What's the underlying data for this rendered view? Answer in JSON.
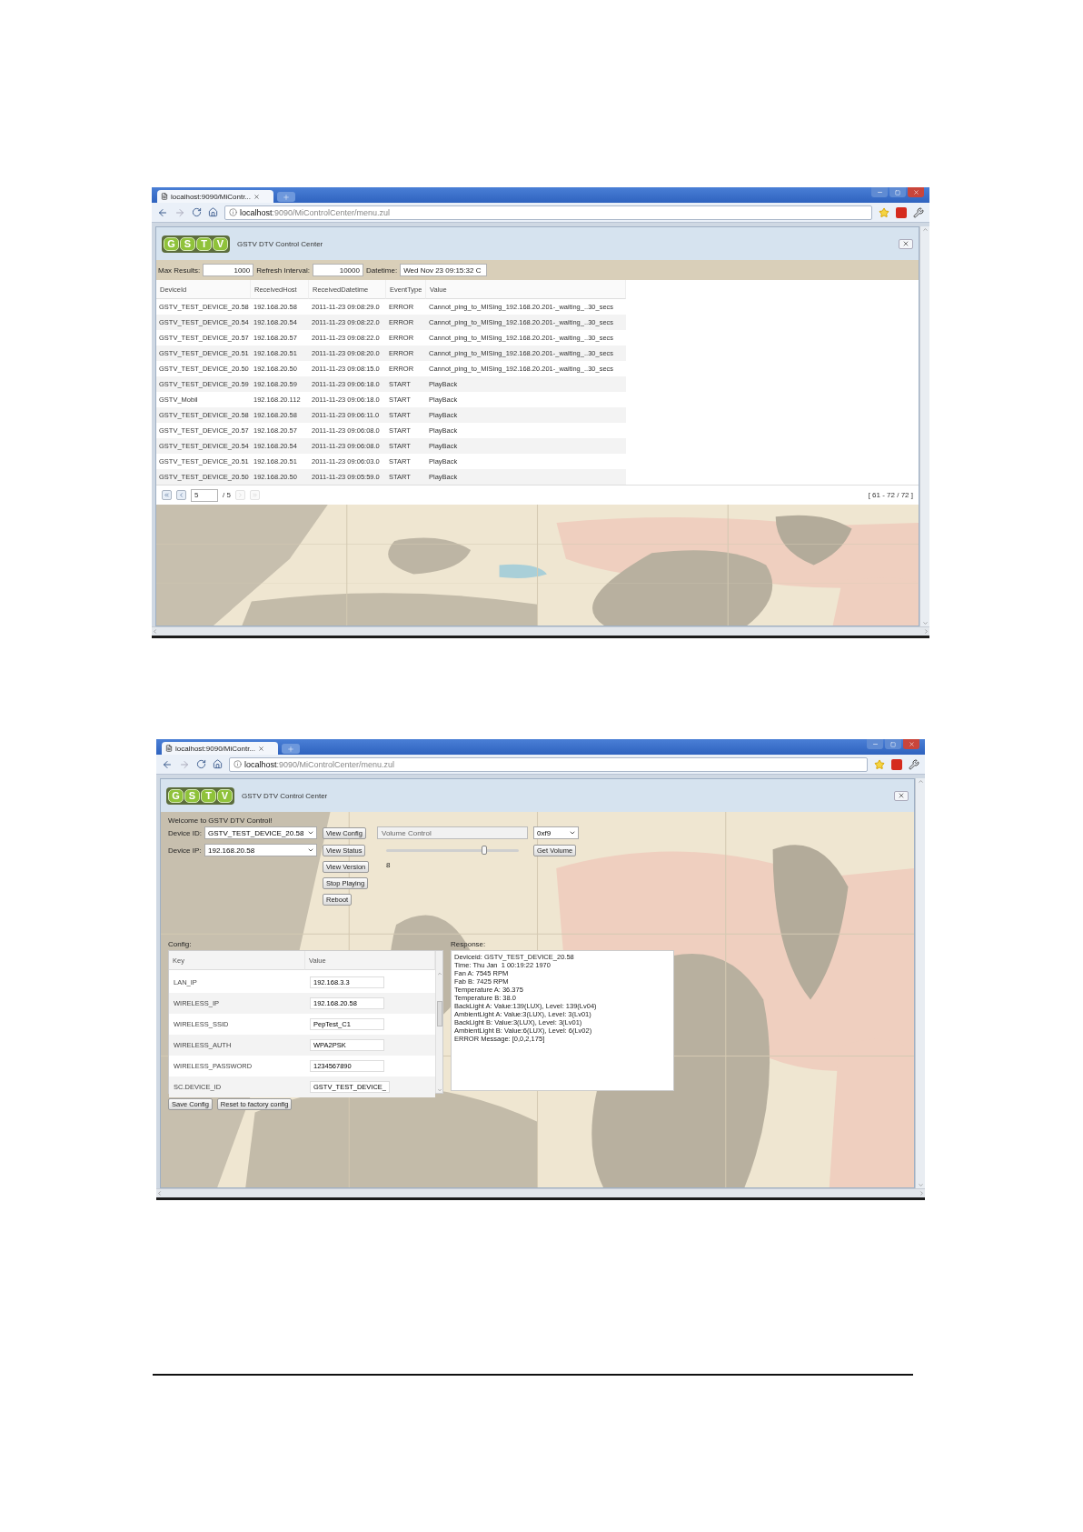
{
  "screenshots": [
    {
      "kind": "event-log",
      "browser": {
        "tab_title": "localhost:9090/MiContr...",
        "url_host": "localhost",
        "url_path": ":9090/MiControlCenter/menu.zul"
      },
      "app": {
        "logo_letters": [
          "G",
          "S",
          "T",
          "V"
        ],
        "title": "GSTV DTV Control Center"
      },
      "filters": [
        {
          "label": "Max Results:",
          "value": "1000"
        },
        {
          "label": "Refresh Interval:",
          "value": "10000"
        },
        {
          "label": "Datetime:",
          "value": "Wed Nov 23 09:15:32 C"
        }
      ],
      "table": {
        "columns": [
          "DeviceId",
          "ReceivedHost",
          "ReceivedDatetime",
          "EventType",
          "Value"
        ],
        "rows": [
          [
            "GSTV_TEST_DEVICE_20.58",
            "192.168.20.58",
            "2011-11-23 09:08:29.0",
            "ERROR",
            "Cannot_ping_to_MISing_192.168.20.201-_waiting_..30_secs"
          ],
          [
            "GSTV_TEST_DEVICE_20.54",
            "192.168.20.54",
            "2011-11-23 09:08:22.0",
            "ERROR",
            "Cannot_ping_to_MISing_192.168.20.201-_waiting_..30_secs"
          ],
          [
            "GSTV_TEST_DEVICE_20.57",
            "192.168.20.57",
            "2011-11-23 09:08:22.0",
            "ERROR",
            "Cannot_ping_to_MISing_192.168.20.201-_waiting_..30_secs"
          ],
          [
            "GSTV_TEST_DEVICE_20.51",
            "192.168.20.51",
            "2011-11-23 09:08:20.0",
            "ERROR",
            "Cannot_ping_to_MISing_192.168.20.201-_waiting_..30_secs"
          ],
          [
            "GSTV_TEST_DEVICE_20.50",
            "192.168.20.50",
            "2011-11-23 09:08:15.0",
            "ERROR",
            "Cannot_ping_to_MISing_192.168.20.201-_waiting_..30_secs"
          ],
          [
            "GSTV_TEST_DEVICE_20.59",
            "192.168.20.59",
            "2011-11-23 09:06:18.0",
            "START",
            "PlayBack"
          ],
          [
            "GSTV_Mobil",
            "192.168.20.112",
            "2011-11-23 09:06:18.0",
            "START",
            "PlayBack"
          ],
          [
            "GSTV_TEST_DEVICE_20.58",
            "192.168.20.58",
            "2011-11-23 09:06:11.0",
            "START",
            "PlayBack"
          ],
          [
            "GSTV_TEST_DEVICE_20.57",
            "192.168.20.57",
            "2011-11-23 09:06:08.0",
            "START",
            "PlayBack"
          ],
          [
            "GSTV_TEST_DEVICE_20.54",
            "192.168.20.54",
            "2011-11-23 09:06:08.0",
            "START",
            "PlayBack"
          ],
          [
            "GSTV_TEST_DEVICE_20.51",
            "192.168.20.51",
            "2011-11-23 09:06:03.0",
            "START",
            "PlayBack"
          ],
          [
            "GSTV_TEST_DEVICE_20.50",
            "192.168.20.50",
            "2011-11-23 09:05:59.0",
            "START",
            "PlayBack"
          ]
        ]
      },
      "pager": {
        "buttons": [
          {
            "kind": "first",
            "disabled": false
          },
          {
            "kind": "prev",
            "disabled": false
          },
          {
            "kind": "next",
            "disabled": true
          },
          {
            "kind": "last",
            "disabled": true
          }
        ],
        "page": "5",
        "total": "/ 5",
        "range": "[ 61 - 72 / 72 ]"
      }
    },
    {
      "kind": "device-control",
      "browser": {
        "tab_title": "localhost:9090/MiContr...",
        "url_host": "localhost",
        "url_path": ":9090/MiControlCenter/menu.zul"
      },
      "app": {
        "logo_letters": [
          "G",
          "S",
          "T",
          "V"
        ],
        "title": "GSTV DTV Control Center"
      },
      "welcome": "Welcome to GSTV DTV Control!",
      "device_id": {
        "label": "Device ID:",
        "value": "GSTV_TEST_DEVICE_20.58"
      },
      "device_ip": {
        "label": "Device IP:",
        "value": "192.168.20.58"
      },
      "buttons": [
        "View Config",
        "View Status",
        "View Version",
        "Stop Playing",
        "Reboot"
      ],
      "volume": {
        "field": "Volume Control",
        "select": "0xf9",
        "level": 0.74,
        "reading": "8",
        "button": "Get Volume"
      },
      "config": {
        "label": "Config:",
        "columns": [
          "Key",
          "Value"
        ],
        "rows": [
          {
            "key": "LAN_IP",
            "value": "192.168.3.3"
          },
          {
            "key": "WIRELESS_IP",
            "value": "192.168.20.58"
          },
          {
            "key": "WIRELESS_SSID",
            "value": "PepTest_C1"
          },
          {
            "key": "WIRELESS_AUTH",
            "value": "WPA2PSK"
          },
          {
            "key": "WIRELESS_PASSWORD",
            "value": "1234567890"
          },
          {
            "key": "SC.DEVICE_ID",
            "value": "GSTV_TEST_DEVICE_"
          }
        ],
        "buttons": [
          "Save Config",
          "Reset to factory config"
        ]
      },
      "response": {
        "label": "Response:",
        "lines": [
          "Deviceid: GSTV_TEST_DEVICE_20.58",
          "Time: Thu Jan  1 00:19:22 1970",
          "Fan A: 7545 RPM",
          "Fab B: 7425 RPM",
          "Temperature A: 36.375",
          "Temperature B: 38.0",
          "BackLight A: Value:139(LUX), Level: 139(Lv04)",
          "AmbientLight A: Value:3(LUX), Level: 3(Lv01)",
          "BackLight B: Value:3(LUX), Level: 3(Lv01)",
          "AmbientLight B: Value:6(LUX), Level: 6(Lv02)",
          "ERROR Message: [0,0,2,175]"
        ]
      }
    }
  ]
}
